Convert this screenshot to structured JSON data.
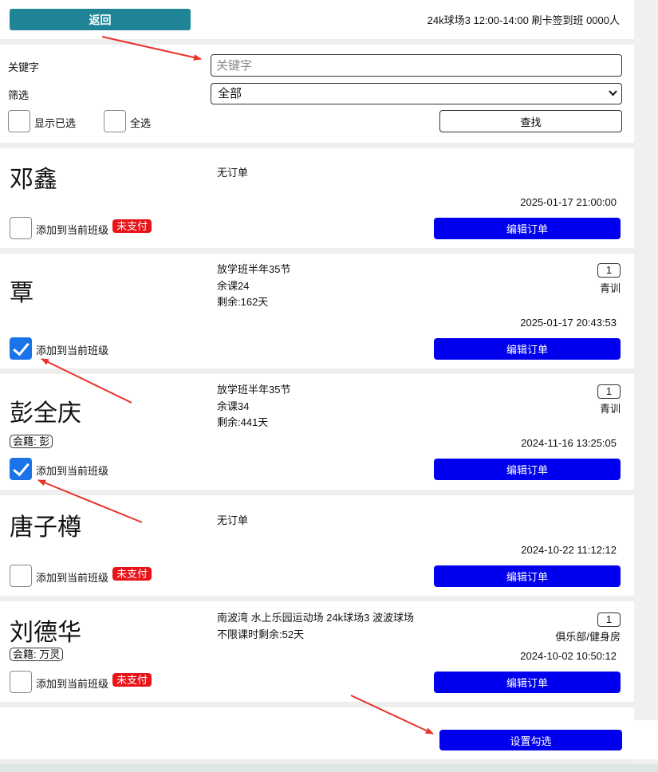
{
  "header": {
    "back_label": "返回",
    "session_info": "24k球场3 12:00-14:00 刷卡签到班 0000人"
  },
  "filter": {
    "keyword_label": "关键字",
    "keyword_value": "",
    "keyword_placeholder": "关键字",
    "filter_label": "筛选",
    "filter_selected": "全部",
    "show_selected_label": "显示已选",
    "select_all_label": "全选",
    "search_label": "查找"
  },
  "common": {
    "add_to_class_label": "添加到当前班级",
    "edit_order_label": "编辑订单",
    "unpaid_label": "未支付"
  },
  "members": [
    {
      "name": "邓鑫",
      "tag": "",
      "order_lines": [
        "无订单"
      ],
      "qty": "",
      "category": "",
      "time": "2025-01-17 21:00:00",
      "checked": false,
      "unpaid": true
    },
    {
      "name": "覃",
      "tag": "",
      "order_lines": [
        "放学班半年35节",
        "余课24",
        "剩余:162天"
      ],
      "qty": "1",
      "category": "青训",
      "time": "2025-01-17 20:43:53",
      "checked": true,
      "unpaid": false
    },
    {
      "name": "彭全庆",
      "tag": "会籍: 彭",
      "order_lines": [
        "放学班半年35节",
        "余课34",
        "剩余:441天"
      ],
      "qty": "1",
      "category": "青训",
      "time": "2024-11-16 13:25:05",
      "checked": true,
      "unpaid": false
    },
    {
      "name": "唐子樽",
      "tag": "",
      "order_lines": [
        "无订单"
      ],
      "qty": "",
      "category": "",
      "time": "2024-10-22 11:12:12",
      "checked": false,
      "unpaid": true
    },
    {
      "name": "刘德华",
      "tag": "会籍: 万灵",
      "order_lines": [
        "南波湾 水上乐园运动场 24k球场3 波波球场",
        "不限课时剩余:52天"
      ],
      "qty": "1",
      "category": "俱乐部/健身房",
      "time": "2024-10-02 10:50:12",
      "checked": false,
      "unpaid": true
    }
  ],
  "footer": {
    "set_checked_label": "设置勾选"
  },
  "colors": {
    "back_button": "#1e8496",
    "primary_button": "#0000ee",
    "unpaid_badge": "#e8141a",
    "checkbox_checked": "#1a73e8",
    "annotation_arrow": "#e8322a"
  }
}
